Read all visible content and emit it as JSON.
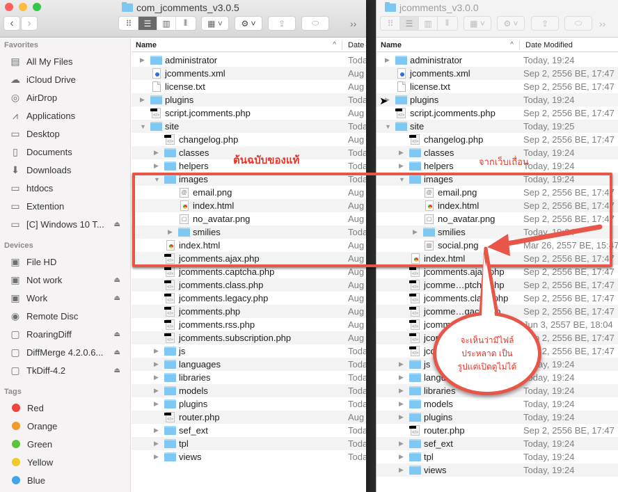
{
  "left_window": {
    "title": "com_jcomments_v3.0.5",
    "nav": {
      "back": "‹",
      "forward": "›"
    },
    "toolbar": {
      "more": "››"
    },
    "columns": {
      "name": "Name",
      "date": "Date"
    },
    "rows": [
      {
        "depth": 0,
        "expand": "closed",
        "icon": "folder",
        "name": "administrator",
        "date": "Toda"
      },
      {
        "depth": 0,
        "expand": "none",
        "icon": "xml",
        "name": "jcomments.xml",
        "date": "Aug"
      },
      {
        "depth": 0,
        "expand": "none",
        "icon": "txt",
        "name": "license.txt",
        "date": "Aug"
      },
      {
        "depth": 0,
        "expand": "closed",
        "icon": "folder",
        "name": "plugins",
        "date": "Toda"
      },
      {
        "depth": 0,
        "expand": "none",
        "icon": "php",
        "name": "script.jcomments.php",
        "date": "Aug"
      },
      {
        "depth": 0,
        "expand": "open",
        "icon": "folder",
        "name": "site",
        "date": "Toda"
      },
      {
        "depth": 1,
        "expand": "none",
        "icon": "php",
        "name": "changelog.php",
        "date": "Aug"
      },
      {
        "depth": 1,
        "expand": "closed",
        "icon": "folder",
        "name": "classes",
        "date": "Toda"
      },
      {
        "depth": 1,
        "expand": "closed",
        "icon": "folder",
        "name": "helpers",
        "date": "Toda"
      },
      {
        "depth": 1,
        "expand": "open",
        "icon": "folder",
        "name": "images",
        "date": "Toda"
      },
      {
        "depth": 2,
        "expand": "none",
        "icon": "img-email",
        "name": "email.png",
        "date": "Aug"
      },
      {
        "depth": 2,
        "expand": "none",
        "icon": "html",
        "name": "index.html",
        "date": "Aug"
      },
      {
        "depth": 2,
        "expand": "none",
        "icon": "img-avatar",
        "name": "no_avatar.png",
        "date": "Aug"
      },
      {
        "depth": 2,
        "expand": "closed",
        "icon": "folder",
        "name": "smilies",
        "date": "Toda"
      },
      {
        "depth": 1,
        "expand": "none",
        "icon": "html",
        "name": "index.html",
        "date": "Aug"
      },
      {
        "depth": 1,
        "expand": "none",
        "icon": "php",
        "name": "jcomments.ajax.php",
        "date": "Aug"
      },
      {
        "depth": 1,
        "expand": "none",
        "icon": "php",
        "name": "jcomments.captcha.php",
        "date": "Aug"
      },
      {
        "depth": 1,
        "expand": "none",
        "icon": "php",
        "name": "jcomments.class.php",
        "date": "Aug"
      },
      {
        "depth": 1,
        "expand": "none",
        "icon": "php",
        "name": "jcomments.legacy.php",
        "date": "Aug"
      },
      {
        "depth": 1,
        "expand": "none",
        "icon": "php",
        "name": "jcomments.php",
        "date": "Aug"
      },
      {
        "depth": 1,
        "expand": "none",
        "icon": "php",
        "name": "jcomments.rss.php",
        "date": "Aug"
      },
      {
        "depth": 1,
        "expand": "none",
        "icon": "php",
        "name": "jcomments.subscription.php",
        "date": "Aug"
      },
      {
        "depth": 1,
        "expand": "closed",
        "icon": "folder",
        "name": "js",
        "date": "Toda"
      },
      {
        "depth": 1,
        "expand": "closed",
        "icon": "folder",
        "name": "languages",
        "date": "Toda"
      },
      {
        "depth": 1,
        "expand": "closed",
        "icon": "folder",
        "name": "libraries",
        "date": "Toda"
      },
      {
        "depth": 1,
        "expand": "closed",
        "icon": "folder",
        "name": "models",
        "date": "Toda"
      },
      {
        "depth": 1,
        "expand": "closed",
        "icon": "folder",
        "name": "plugins",
        "date": "Toda"
      },
      {
        "depth": 1,
        "expand": "none",
        "icon": "php",
        "name": "router.php",
        "date": "Aug"
      },
      {
        "depth": 1,
        "expand": "closed",
        "icon": "folder",
        "name": "sef_ext",
        "date": "Toda"
      },
      {
        "depth": 1,
        "expand": "closed",
        "icon": "folder",
        "name": "tpl",
        "date": "Toda"
      },
      {
        "depth": 1,
        "expand": "closed",
        "icon": "folder",
        "name": "views",
        "date": "Toda"
      }
    ]
  },
  "right_window": {
    "title": "jcomments_v3.0.0",
    "toolbar": {
      "more": "››"
    },
    "columns": {
      "name": "Name",
      "date": "Date Modified"
    },
    "rows": [
      {
        "depth": 0,
        "expand": "closed",
        "icon": "folder",
        "name": "administrator",
        "date": "Today, 19:24"
      },
      {
        "depth": 0,
        "expand": "none",
        "icon": "xml",
        "name": "jcomments.xml",
        "date": "Sep 2, 2556 BE, 17:47"
      },
      {
        "depth": 0,
        "expand": "none",
        "icon": "txt",
        "name": "license.txt",
        "date": "Sep 2, 2556 BE, 17:47"
      },
      {
        "depth": 0,
        "expand": "closed",
        "icon": "folder",
        "name": "plugins",
        "date": "Today, 19:24"
      },
      {
        "depth": 0,
        "expand": "none",
        "icon": "php",
        "name": "script.jcomments.php",
        "date": "Sep 2, 2556 BE, 17:47"
      },
      {
        "depth": 0,
        "expand": "open",
        "icon": "folder",
        "name": "site",
        "date": "Today, 19:25"
      },
      {
        "depth": 1,
        "expand": "none",
        "icon": "php",
        "name": "changelog.php",
        "date": "Sep 2, 2556 BE, 17:47"
      },
      {
        "depth": 1,
        "expand": "closed",
        "icon": "folder",
        "name": "classes",
        "date": "Today, 19:24"
      },
      {
        "depth": 1,
        "expand": "closed",
        "icon": "folder",
        "name": "helpers",
        "date": "Today, 19:24"
      },
      {
        "depth": 1,
        "expand": "open",
        "icon": "folder",
        "name": "images",
        "date": "Today, 19:24"
      },
      {
        "depth": 2,
        "expand": "none",
        "icon": "img-email",
        "name": "email.png",
        "date": "Sep 2, 2556 BE, 17:47"
      },
      {
        "depth": 2,
        "expand": "none",
        "icon": "html",
        "name": "index.html",
        "date": "Sep 2, 2556 BE, 17:47"
      },
      {
        "depth": 2,
        "expand": "none",
        "icon": "img-avatar",
        "name": "no_avatar.png",
        "date": "Sep 2, 2556 BE, 17:47"
      },
      {
        "depth": 2,
        "expand": "closed",
        "icon": "folder",
        "name": "smilies",
        "date": "Today, 19:24"
      },
      {
        "depth": 2,
        "expand": "none",
        "icon": "img-social",
        "name": "social.png",
        "date": "Mar 26, 2557 BE, 15:47"
      },
      {
        "depth": 1,
        "expand": "none",
        "icon": "html",
        "name": "index.html",
        "date": "Sep 2, 2556 BE, 17:47"
      },
      {
        "depth": 1,
        "expand": "none",
        "icon": "php",
        "name": "jcomments.ajax.php",
        "date": "Sep 2, 2556 BE, 17:47"
      },
      {
        "depth": 1,
        "expand": "none",
        "icon": "php",
        "name": "jcomme…ptcha.php",
        "date": "Sep 2, 2556 BE, 17:47"
      },
      {
        "depth": 1,
        "expand": "none",
        "icon": "php",
        "name": "jcomments.class.php",
        "date": "Sep 2, 2556 BE, 17:47"
      },
      {
        "depth": 1,
        "expand": "none",
        "icon": "php",
        "name": "jcomme…gacy.php",
        "date": "Sep 2, 2556 BE, 17:47"
      },
      {
        "depth": 1,
        "expand": "none",
        "icon": "php",
        "name": "jcomments.php",
        "date": "Jun 3, 2557 BE, 18:04"
      },
      {
        "depth": 1,
        "expand": "none",
        "icon": "php",
        "name": "jcomments.rss.php",
        "date": "Sep 2, 2556 BE, 17:47"
      },
      {
        "depth": 1,
        "expand": "none",
        "icon": "php",
        "name": "jcomme…ption.php",
        "date": "Sep 2, 2556 BE, 17:47"
      },
      {
        "depth": 1,
        "expand": "closed",
        "icon": "folder",
        "name": "js",
        "date": "Today, 19:24"
      },
      {
        "depth": 1,
        "expand": "closed",
        "icon": "folder",
        "name": "languages",
        "date": "Today, 19:24"
      },
      {
        "depth": 1,
        "expand": "closed",
        "icon": "folder",
        "name": "libraries",
        "date": "Today, 19:24"
      },
      {
        "depth": 1,
        "expand": "closed",
        "icon": "folder",
        "name": "models",
        "date": "Today, 19:24"
      },
      {
        "depth": 1,
        "expand": "closed",
        "icon": "folder",
        "name": "plugins",
        "date": "Today, 19:24"
      },
      {
        "depth": 1,
        "expand": "none",
        "icon": "php",
        "name": "router.php",
        "date": "Sep 2, 2556 BE, 17:47"
      },
      {
        "depth": 1,
        "expand": "closed",
        "icon": "folder",
        "name": "sef_ext",
        "date": "Today, 19:24"
      },
      {
        "depth": 1,
        "expand": "closed",
        "icon": "folder",
        "name": "tpl",
        "date": "Today, 19:24"
      },
      {
        "depth": 1,
        "expand": "closed",
        "icon": "folder",
        "name": "views",
        "date": "Today, 19:24"
      }
    ]
  },
  "sidebar": {
    "sections": [
      {
        "title": "Favorites",
        "items": [
          {
            "label": "All My Files",
            "icon": "all-files-icon",
            "glyph": "▤",
            "eject": false
          },
          {
            "label": "iCloud Drive",
            "icon": "cloud-icon",
            "glyph": "☁",
            "eject": false
          },
          {
            "label": "AirDrop",
            "icon": "airdrop-icon",
            "glyph": "◎",
            "eject": false
          },
          {
            "label": "Applications",
            "icon": "applications-icon",
            "glyph": "⩘",
            "eject": false
          },
          {
            "label": "Desktop",
            "icon": "desktop-icon",
            "glyph": "▭",
            "eject": false
          },
          {
            "label": "Documents",
            "icon": "documents-icon",
            "glyph": "▯",
            "eject": false
          },
          {
            "label": "Downloads",
            "icon": "downloads-icon",
            "glyph": "⬇",
            "eject": false
          },
          {
            "label": "htdocs",
            "icon": "folder-icon",
            "glyph": "▭",
            "eject": false
          },
          {
            "label": "Extention",
            "icon": "folder-icon",
            "glyph": "▭",
            "eject": false
          },
          {
            "label": "[C] Windows 10 T...",
            "icon": "folder-icon",
            "glyph": "▭",
            "eject": true
          }
        ]
      },
      {
        "title": "Devices",
        "items": [
          {
            "label": "File HD",
            "icon": "hard-drive-icon",
            "glyph": "▣",
            "eject": false
          },
          {
            "label": "Not work",
            "icon": "hard-drive-icon",
            "glyph": "▣",
            "eject": true
          },
          {
            "label": "Work",
            "icon": "hard-drive-icon",
            "glyph": "▣",
            "eject": true
          },
          {
            "label": "Remote Disc",
            "icon": "disc-icon",
            "glyph": "◉",
            "eject": false
          },
          {
            "label": "RoaringDiff",
            "icon": "disk-image-icon",
            "glyph": "▢",
            "eject": true
          },
          {
            "label": "DiffMerge 4.2.0.6...",
            "icon": "disk-image-icon",
            "glyph": "▢",
            "eject": true
          },
          {
            "label": "TkDiff-4.2",
            "icon": "disk-image-icon",
            "glyph": "▢",
            "eject": true
          }
        ]
      },
      {
        "title": "Tags",
        "items": [
          {
            "label": "Red",
            "tag_color": "#f0443c"
          },
          {
            "label": "Orange",
            "tag_color": "#f39a2b"
          },
          {
            "label": "Green",
            "tag_color": "#5cc43a"
          },
          {
            "label": "Yellow",
            "tag_color": "#f2c92a"
          },
          {
            "label": "Blue",
            "tag_color": "#3ea6ee"
          }
        ]
      }
    ]
  },
  "annotations": {
    "left_label": "ต้นฉบับของแท้",
    "right_label": "จากเว็บเถื่อน",
    "callout_lines": [
      "จะเห็นว่ามีไฟล์",
      "ประหลาด เป็น",
      "รูปแต่เปิดดูไม่ได้"
    ],
    "accent_color": "#e8564a"
  },
  "eject_glyph": "⏏",
  "colors": {
    "folder": "#7fc8f4",
    "selected_view": "#6a6a6a",
    "traffic_red": "#fc605c",
    "traffic_yellow": "#fdbc40",
    "traffic_green": "#34c84a"
  }
}
